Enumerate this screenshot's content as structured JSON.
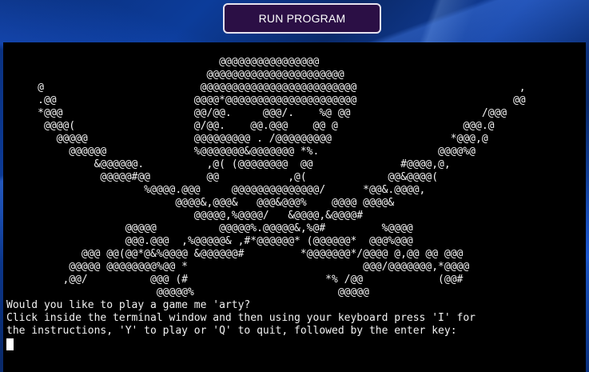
{
  "toolbar": {
    "run_label": "RUN PROGRAM"
  },
  "terminal": {
    "art_lines": [
      "                                  @@@@@@@@@@@@@@@@",
      "                                @@@@@@@@@@@@@@@@@@@@@@",
      "     @                         @@@@@@@@@@@@@@@@@@@@@@@@@                          ,",
      "     .@@                      @@@@*@@@@@@@@@@@@@@@@@@@@@                         @@",
      "     *@@@                     @@/@@.     @@@/.    %@ @@                     /@@@",
      "      @@@@(                   @/@@.    @@.@@@    @@ @                    @@@.@",
      "        @@@@@                 @@@@@@@@@ . /@@@@@@@@@                   *@@@,@",
      "          @@@@@@              %@@@@@@@&@@@@@@@ *%.                   @@@@%@",
      "              &@@@@@@.          ,@( (@@@@@@@@  @@              #@@@@,@,",
      "               @@@@@#@@         @@           ,@(             @@&@@@@(",
      "                      %@@@@.@@@     @@@@@@@@@@@@@@/      *@@&.@@@@,",
      "                           @@@@&,@@@&   @@@&@@@%    @@@@ @@@@&",
      "                              @@@@@,%@@@@/   &@@@@,&@@@@#",
      "                   @@@@@          @@@@@%.@@@@@&,%@#         %@@@@",
      "                   @@@.@@@  ,%@@@@@& ,#*@@@@@@* (@@@@@@*  @@@%@@@",
      "            @@@ @@(@@*@&%@@@@ &@@@@@@#         *@@@@@@@*/@@@@ @,@@ @@ @@@",
      "          @@@@@ @@@@@@@@%@@ *                            @@@/@@@@@@@,*@@@@",
      "         ,@@/          @@@ (#                      *% /@@            (@@#",
      "                        @@@@@%                       @@@@@"
    ],
    "prompt_lines": [
      "Would you like to play a game me 'arty?",
      "Click inside the terminal window and then using your keyboard press 'I' for",
      "the instructions, 'Y' to play or 'Q' to quit, followed by the enter key:"
    ]
  }
}
